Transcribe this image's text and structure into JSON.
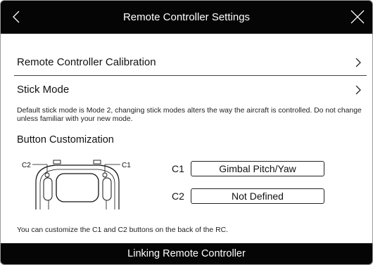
{
  "header": {
    "title": "Remote Controller Settings",
    "back_icon": "chevron-left-icon",
    "close_icon": "close-icon"
  },
  "menu": {
    "calibration_label": "Remote Controller Calibration",
    "stick_mode_label": "Stick Mode",
    "chevron_icon": "chevron-right-icon"
  },
  "stick_mode_description": "Default stick mode is Mode 2, changing stick modes alters the way the aircraft is controlled. Do not change unless familiar with your new mode.",
  "button_customization": {
    "title": "Button Customization",
    "diagram": {
      "c2_callout": "C2",
      "c1_callout": "C1"
    },
    "c1": {
      "label": "C1",
      "value": "Gimbal Pitch/Yaw"
    },
    "c2": {
      "label": "C2",
      "value": "Not Defined"
    },
    "footnote": "You can customize the C1 and C2 buttons on the back of the RC."
  },
  "footer": {
    "link_label": "Linking Remote Controller"
  },
  "colors": {
    "bar_background": "#050505",
    "bar_text": "#ffffff",
    "page_background": "#ffffff"
  }
}
